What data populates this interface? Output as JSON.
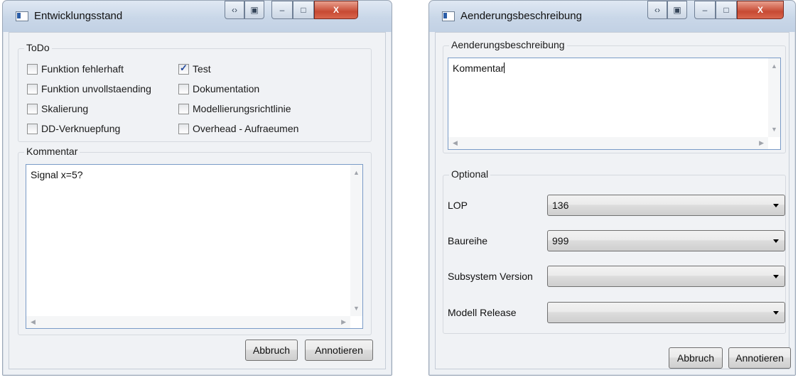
{
  "left_window": {
    "title": "Entwicklungsstand",
    "todo_legend": "ToDo",
    "checkboxes": [
      {
        "label": "Funktion fehlerhaft",
        "checked": false
      },
      {
        "label": "Test",
        "checked": true
      },
      {
        "label": "Funktion unvollstaending",
        "checked": false
      },
      {
        "label": "Dokumentation",
        "checked": false
      },
      {
        "label": "Skalierung",
        "checked": false
      },
      {
        "label": "Modellierungsrichtlinie",
        "checked": false
      },
      {
        "label": "DD-Verknuepfung",
        "checked": false
      },
      {
        "label": "Overhead - Aufraeumen",
        "checked": false
      }
    ],
    "comment_legend": "Kommentar",
    "comment_text": "Signal x=5?",
    "cancel_label": "Abbruch",
    "annotate_label": "Annotieren"
  },
  "right_window": {
    "title": "Aenderungsbeschreibung",
    "description_legend": "Aenderungsbeschreibung",
    "description_text": "Kommentar",
    "optional_legend": "Optional",
    "fields": [
      {
        "label": "LOP",
        "value": "136"
      },
      {
        "label": "Baureihe",
        "value": "999"
      },
      {
        "label": "Subsystem Version",
        "value": ""
      },
      {
        "label": "Modell Release",
        "value": ""
      }
    ],
    "cancel_label": "Abbruch",
    "annotate_label": "Annotieren"
  },
  "caption_buttons": {
    "minimize": "–",
    "maximize": "□",
    "close": "X"
  }
}
